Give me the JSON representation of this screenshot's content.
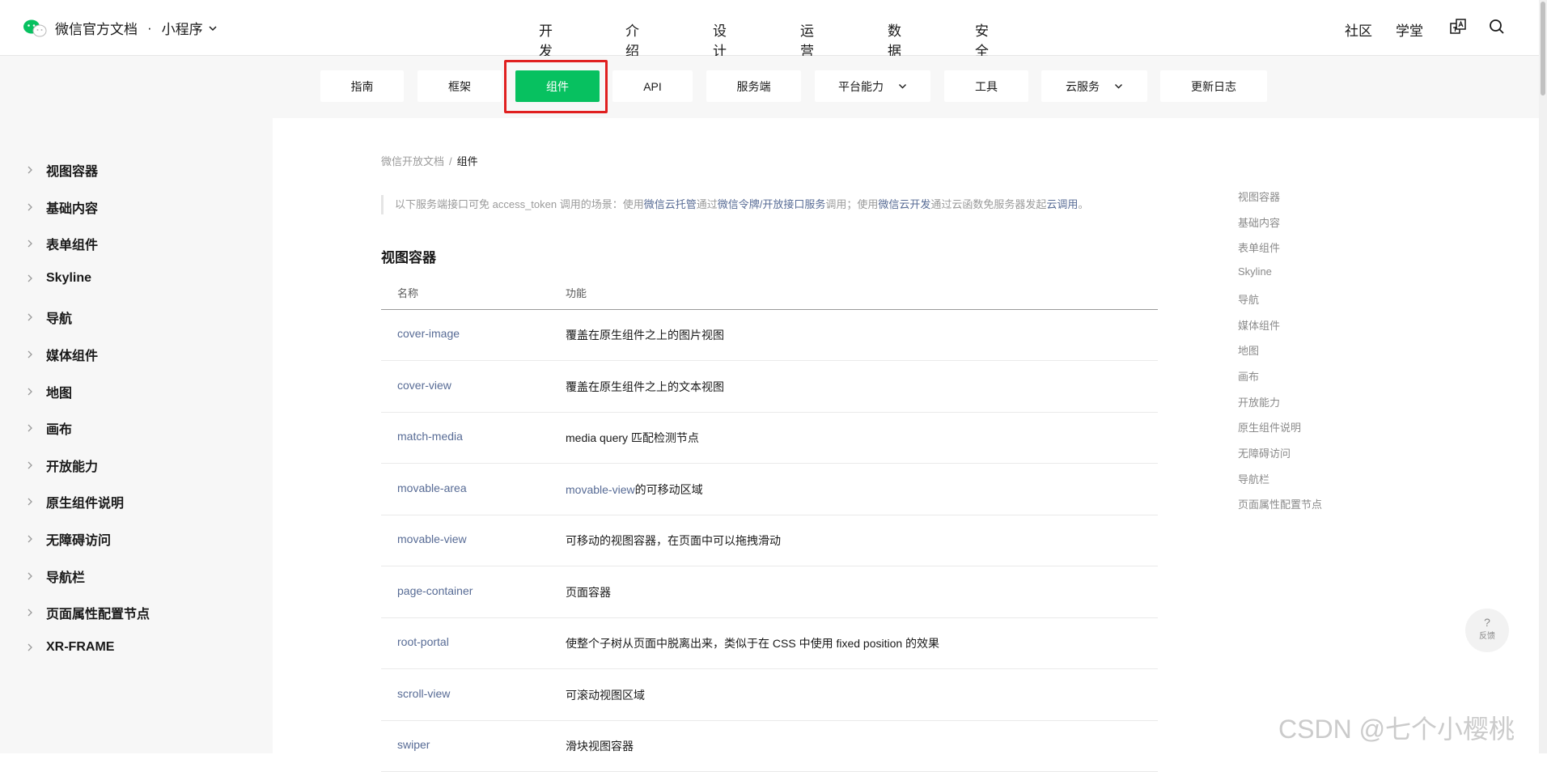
{
  "header": {
    "brand": "微信官方文档",
    "dot": "·",
    "product": "小程序",
    "nav": [
      "开发",
      "介绍",
      "设计",
      "运营",
      "数据",
      "安全"
    ],
    "active_nav": "开发",
    "right_links": [
      "社区",
      "学堂"
    ]
  },
  "subnav": {
    "items": [
      "指南",
      "框架",
      "组件",
      "API",
      "服务端",
      "平台能力",
      "工具",
      "云服务",
      "更新日志"
    ],
    "active": "组件",
    "dropdown_items": [
      "平台能力",
      "云服务"
    ]
  },
  "sidebar": {
    "items": [
      "视图容器",
      "基础内容",
      "表单组件",
      "Skyline",
      "导航",
      "媒体组件",
      "地图",
      "画布",
      "开放能力",
      "原生组件说明",
      "无障碍访问",
      "导航栏",
      "页面属性配置节点",
      "XR-FRAME"
    ]
  },
  "breadcrumb": {
    "root": "微信开放文档",
    "sep": "/",
    "current": "组件"
  },
  "notice": {
    "t1": "以下服务端接口可免 access_token 调用的场景：使用",
    "l1": "微信云托管",
    "t2": "通过",
    "l2": "微信令牌/开放接口服务",
    "t3": "调用；使用",
    "l3": "微信云开发",
    "t4": "通过云函数免服务器发起",
    "l4": "云调用",
    "t5": "。"
  },
  "section": {
    "title": "视图容器",
    "col_name": "名称",
    "col_desc": "功能",
    "rows": [
      {
        "name": "cover-image",
        "desc": "覆盖在原生组件之上的图片视图"
      },
      {
        "name": "cover-view",
        "desc": "覆盖在原生组件之上的文本视图"
      },
      {
        "name": "match-media",
        "desc": "media query 匹配检测节点"
      },
      {
        "name": "movable-area",
        "desc_link": "movable-view",
        "desc": "的可移动区域"
      },
      {
        "name": "movable-view",
        "desc": "可移动的视图容器，在页面中可以拖拽滑动"
      },
      {
        "name": "page-container",
        "desc": "页面容器"
      },
      {
        "name": "root-portal",
        "desc": "使整个子树从页面中脱离出来，类似于在 CSS 中使用 fixed position 的效果"
      },
      {
        "name": "scroll-view",
        "desc": "可滚动视图区域"
      },
      {
        "name": "swiper",
        "desc": "滑块视图容器"
      }
    ]
  },
  "toc": [
    "视图容器",
    "基础内容",
    "表单组件",
    "Skyline",
    "导航",
    "媒体组件",
    "地图",
    "画布",
    "开放能力",
    "原生组件说明",
    "无障碍访问",
    "导航栏",
    "页面属性配置节点"
  ],
  "feedback": {
    "q": "?",
    "label": "反馈"
  },
  "watermark": "CSDN @七个小樱桃",
  "colors": {
    "accent": "#07c160",
    "link": "#576b95",
    "highlight": "#e02020"
  }
}
